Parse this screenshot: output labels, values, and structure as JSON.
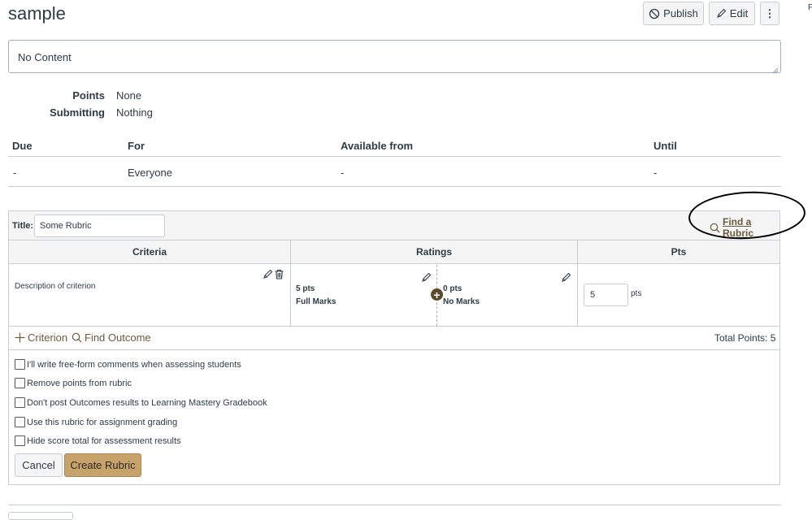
{
  "page": {
    "title": "sample",
    "edge_glyph": "F"
  },
  "header_actions": {
    "publish_label": "Publish",
    "edit_label": "Edit",
    "more_label": "⋮"
  },
  "description": {
    "content": "No Content"
  },
  "details": {
    "points_label": "Points",
    "points_value": "None",
    "submitting_label": "Submitting",
    "submitting_value": "Nothing"
  },
  "dates_table": {
    "headers": [
      "Due",
      "For",
      "Available from",
      "Until"
    ],
    "rows": [
      [
        "-",
        "Everyone",
        "-",
        "-"
      ]
    ]
  },
  "rubric": {
    "title_label": "Title:",
    "title_value": "Some Rubric",
    "find_rubric_label": "Find a Rubric",
    "columns": {
      "criteria": "Criteria",
      "ratings": "Ratings",
      "pts": "Pts"
    },
    "criterion": {
      "description": "Description of criterion",
      "ratings": [
        {
          "points": "5 pts",
          "description": "Full Marks"
        },
        {
          "points": "0 pts",
          "description": "No Marks"
        }
      ],
      "points_value": "5",
      "points_unit": "pts"
    },
    "add_criterion_label": "Criterion",
    "find_outcome_label": "Find Outcome",
    "total_points": "Total Points: 5",
    "options": [
      "I'll write free-form comments when assessing students",
      "Remove points from rubric",
      "Don't post Outcomes results to Learning Mastery Gradebook",
      "Use this rubric for assignment grading",
      "Hide score total for assessment results"
    ],
    "cancel_label": "Cancel",
    "create_label": "Create Rubric"
  },
  "colors": {
    "accent": "#c7a36b",
    "link": "#6b5a3a",
    "border": "#c7cdd1",
    "text": "#2d3b45"
  }
}
